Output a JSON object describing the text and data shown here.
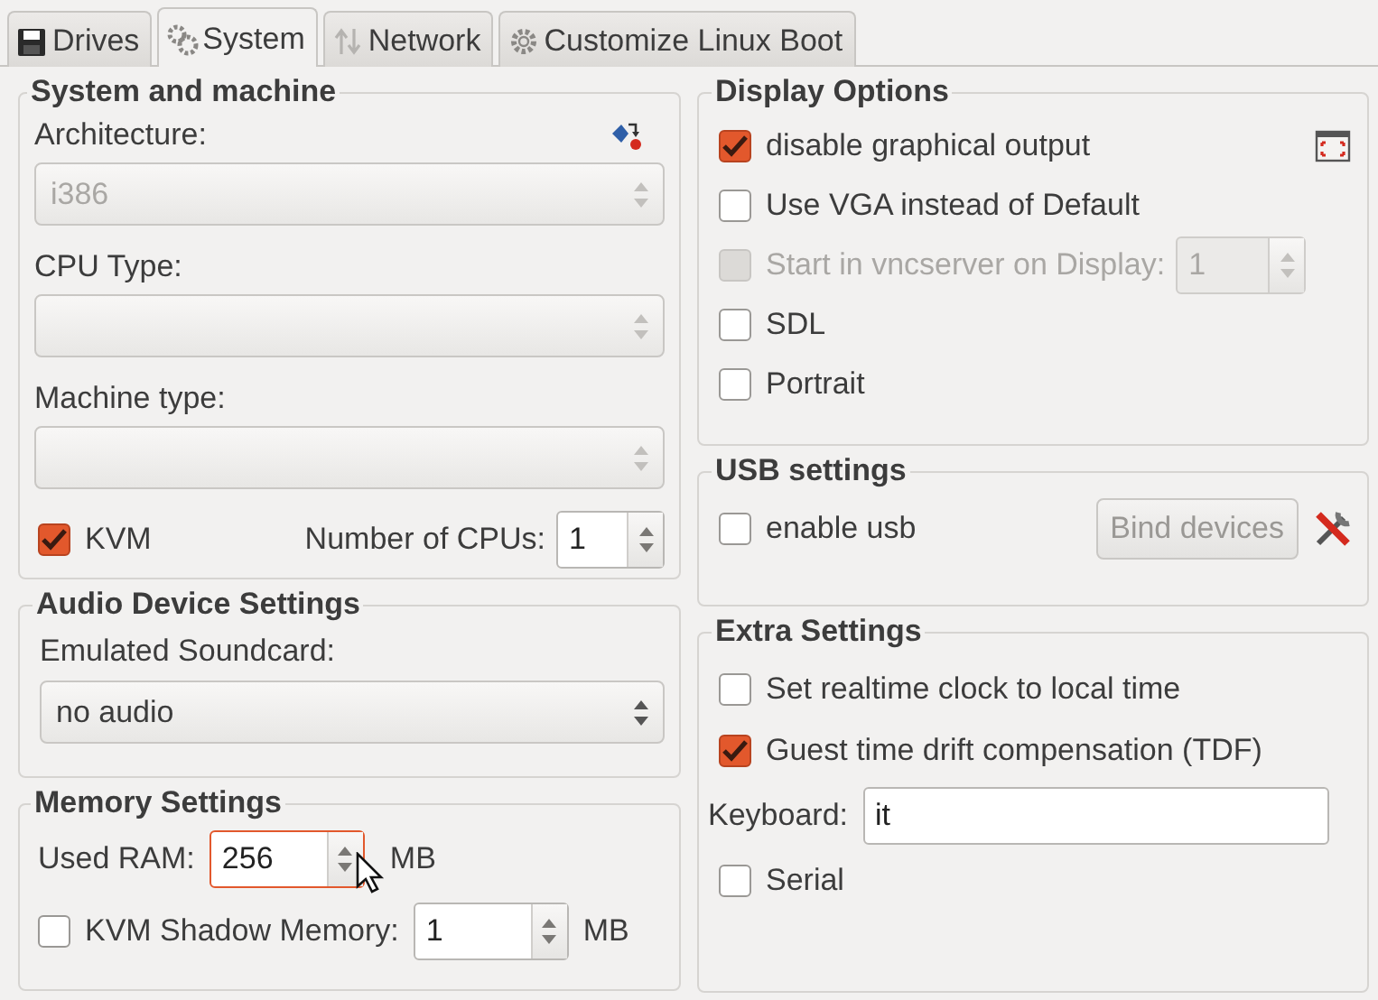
{
  "tabs": [
    {
      "label": "Drives",
      "selected": false
    },
    {
      "label": "System",
      "selected": true
    },
    {
      "label": "Network",
      "selected": false
    },
    {
      "label": "Customize Linux Boot",
      "selected": false
    }
  ],
  "system_and_machine": {
    "title": "System and machine",
    "combos": [
      {
        "label": "Architecture:",
        "value": "i386",
        "disabled": true
      },
      {
        "label": "CPU Type:",
        "disabled": true
      },
      {
        "label": "Machine type:",
        "disabled": true
      }
    ],
    "kvm": {
      "label": "KVM",
      "checked": true
    },
    "cpus": {
      "label": "Number of CPUs:",
      "value": "1"
    }
  },
  "audio": {
    "title": "Audio Device Settings",
    "soundcard": {
      "label": "Emulated Soundcard:",
      "value": "no audio",
      "disabled": false
    }
  },
  "memory": {
    "title": "Memory Settings",
    "used_ram": {
      "label": "Used RAM:",
      "value": "256",
      "unit": "MB",
      "focused": true
    },
    "shadow": {
      "label": "KVM Shadow Memory:",
      "checked": false,
      "value": "1",
      "unit": "MB"
    }
  },
  "display_options": {
    "title": "Display Options",
    "options": [
      {
        "kind": "checkbox",
        "label": "disable graphical output",
        "checked": true,
        "disabled": false
      },
      {
        "kind": "checkbox",
        "label": "Use VGA instead of Default",
        "checked": false,
        "disabled": false
      },
      {
        "kind": "checkbox_spin",
        "label": "Start in vncserver on Display:",
        "checked": false,
        "disabled": true,
        "value": "1"
      },
      {
        "kind": "checkbox",
        "label": "SDL",
        "checked": false,
        "disabled": false
      },
      {
        "kind": "checkbox",
        "label": "Portrait",
        "checked": false,
        "disabled": false
      }
    ]
  },
  "usb": {
    "title": "USB settings",
    "enable": {
      "label": "enable usb",
      "checked": false
    },
    "bind_button": {
      "label": "Bind devices",
      "disabled": true
    }
  },
  "extra": {
    "title": "Extra Settings",
    "items": [
      {
        "kind": "checkbox",
        "label": "Set realtime clock to local time",
        "checked": false
      },
      {
        "kind": "checkbox",
        "label": "Guest time drift compensation (TDF)",
        "checked": true
      },
      {
        "kind": "text",
        "label": "Keyboard:",
        "value": "it"
      },
      {
        "kind": "checkbox",
        "label": "Serial",
        "checked": false
      }
    ]
  }
}
